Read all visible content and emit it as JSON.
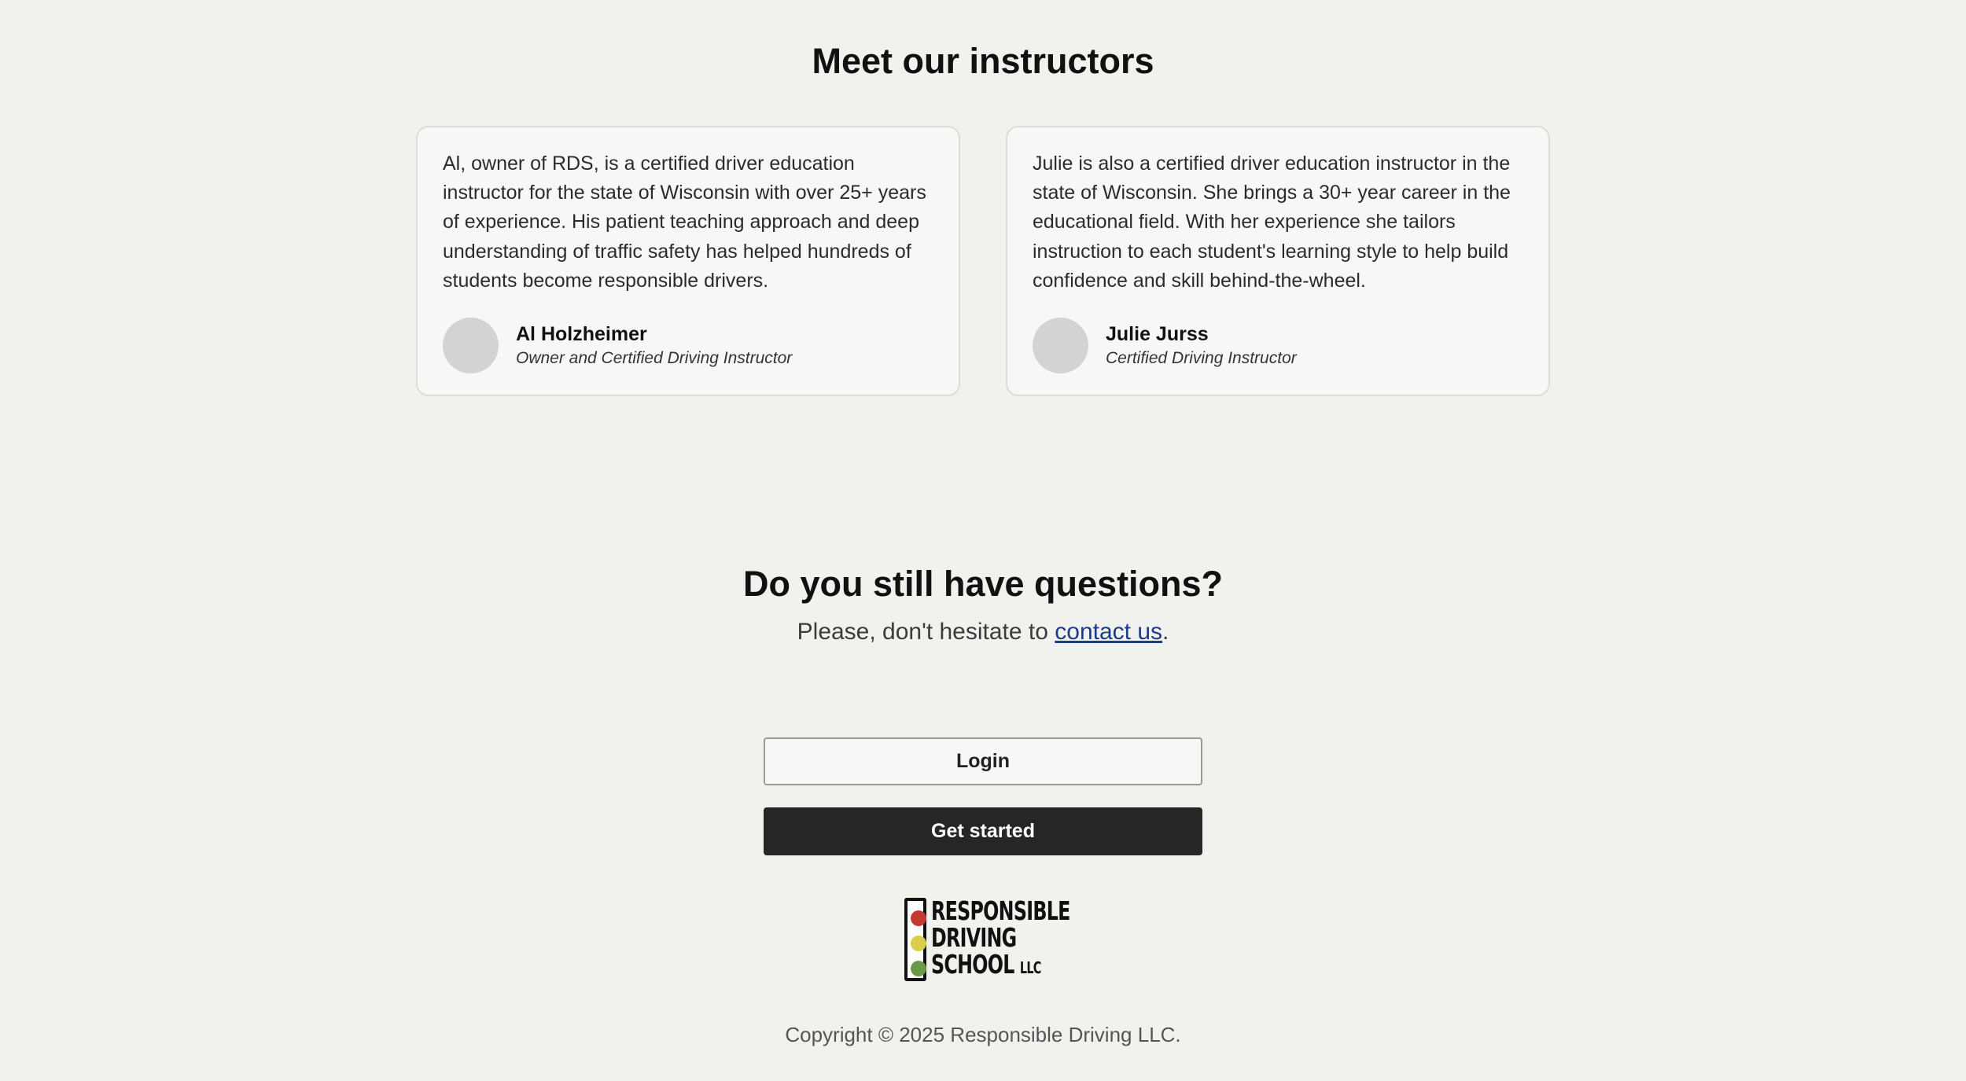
{
  "instructors": {
    "title": "Meet our instructors",
    "cards": [
      {
        "bio": "Al, owner of RDS, is a certified driver education instructor for the state of Wisconsin with over 25+ years of experience. His patient teaching approach and deep understanding of traffic safety has helped hundreds of students become responsible drivers.",
        "name": "Al Holzheimer",
        "role": "Owner and Certified Driving Instructor"
      },
      {
        "bio": "Julie is also a certified driver education instructor in the state of Wisconsin. She brings a 30+ year career in the educational field. With her experience she tailors instruction to each student's learning style to help build confidence and skill behind-the-wheel.",
        "name": "Julie Jurss",
        "role": "Certified Driving Instructor"
      }
    ]
  },
  "questions": {
    "title": "Do you still have questions?",
    "subtitle_before": "Please, don't hesitate to ",
    "contact_link": "contact us",
    "subtitle_after": "."
  },
  "actions": {
    "login_label": "Login",
    "get_started_label": "Get started"
  },
  "logo": {
    "line1": "RESPONSIBLE",
    "line2": "DRIVING",
    "line3": "SCHOOL",
    "suffix": "LLC",
    "colors": {
      "red": "#c43a33",
      "yellow": "#d9cf4a",
      "green": "#6a9a45"
    }
  },
  "footer": {
    "copyright": "Copyright © 2025 Responsible Driving LLC."
  }
}
